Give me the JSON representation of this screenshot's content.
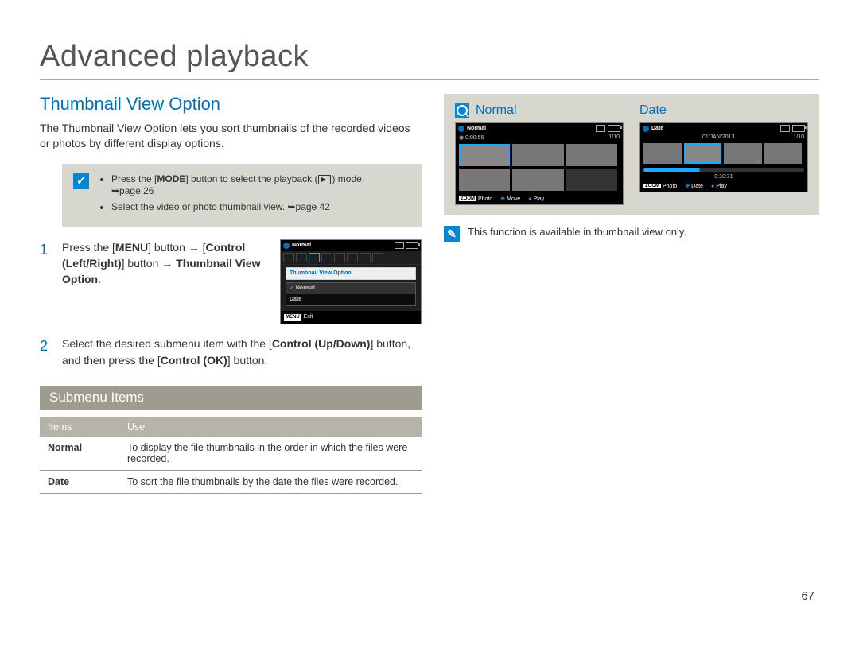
{
  "page_title": "Advanced playback",
  "page_number": "67",
  "section_heading": "Thumbnail View Option",
  "intro": "The Thumbnail View Option lets you sort thumbnails of the recorded videos or photos by different display options.",
  "note_box": {
    "item1_pre": "Press the [",
    "item1_mode": "MODE",
    "item1_mid": "] button to select the playback (",
    "item1_post": ") mode.",
    "item1_page": "➥page 26",
    "item2": "Select the video or photo thumbnail view. ➥page 42"
  },
  "steps": {
    "s1": {
      "num": "1",
      "text_pre": "Press the [",
      "menu": "MENU",
      "text_mid": "] button → [",
      "control_lr": "Control (Left/Right)",
      "text_mid2": "] button → ",
      "option": "Thumbnail View Option",
      "dot": "."
    },
    "s2": {
      "num": "2",
      "text_pre": "Select the desired submenu item with the [",
      "control_ud": "Control (Up/Down)",
      "text_mid": "] button, and then press the [",
      "control_ok": "Control (OK)",
      "text_post": "] button."
    }
  },
  "mini": {
    "title": "Normal",
    "dropdown": "Thumbnail View Option",
    "opt_normal": "Normal",
    "opt_date": "Date",
    "menu_label": "MENU",
    "exit": "Exit"
  },
  "submenu_bar": "Submenu Items",
  "table": {
    "col1": "Items",
    "col2": "Use",
    "row1_item": "Normal",
    "row1_use": "To display the file thumbnails in the order in which the files were recorded.",
    "row2_item": "Date",
    "row2_use": "To sort the file thumbnails by the date the files were recorded."
  },
  "preview": {
    "normal_title": "Normal",
    "date_title": "Date",
    "normal_header": "Normal",
    "date_header": "Date",
    "duration": "0:00:55",
    "counter": "1/10",
    "date_str": "01/JAN/2013",
    "date_time": "0:10:31",
    "zoom": "ZOOM",
    "photo": "Photo",
    "move": "Move",
    "date_key": "Date",
    "play": "Play"
  },
  "footnote": "This function is available in thumbnail view only."
}
